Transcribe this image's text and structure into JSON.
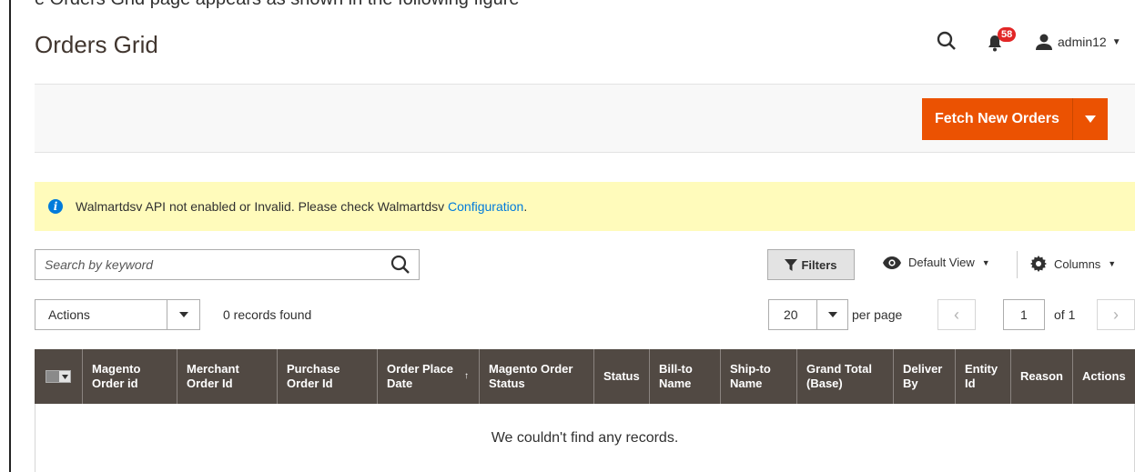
{
  "caption_fragment": "e Orders Grid page appears as shown in the following figure",
  "header": {
    "title": "Orders Grid",
    "notification_count": "58",
    "username": "admin12"
  },
  "toolbar": {
    "fetch_label": "Fetch New Orders"
  },
  "notice": {
    "text": "Walmartdsv API not enabled or Invalid. Please check Walmartdsv ",
    "link_text": "Configuration",
    "suffix": "."
  },
  "search": {
    "placeholder": "Search by keyword"
  },
  "controls": {
    "filters_label": "Filters",
    "view_label": "Default View",
    "columns_label": "Columns",
    "actions_label": "Actions",
    "records_found": "0 records found",
    "per_page_value": "20",
    "per_page_label": "per page",
    "current_page": "1",
    "of_pages": "of 1"
  },
  "grid": {
    "columns": [
      {
        "l1": "Magento",
        "l2": "Order id"
      },
      {
        "l1": "Merchant",
        "l2": "Order Id"
      },
      {
        "l1": "Purchase",
        "l2": "Order Id"
      },
      {
        "l1": "Order Place",
        "l2": "Date"
      },
      {
        "l1": "Magento Order",
        "l2": "Status"
      },
      {
        "l1": "Status",
        "l2": ""
      },
      {
        "l1": "Bill-to",
        "l2": "Name"
      },
      {
        "l1": "Ship-to",
        "l2": "Name"
      },
      {
        "l1": "Grand Total",
        "l2": "(Base)"
      },
      {
        "l1": "Deliver",
        "l2": "By"
      },
      {
        "l1": "Entity",
        "l2": "Id"
      },
      {
        "l1": "Reason",
        "l2": ""
      },
      {
        "l1": "Actions",
        "l2": ""
      }
    ],
    "empty_message": "We couldn't find any records."
  },
  "colors": {
    "accent": "#eb5202",
    "grid_header": "#514943",
    "notice_bg": "#fffbbb",
    "link": "#007bdb",
    "badge": "#e22626"
  }
}
